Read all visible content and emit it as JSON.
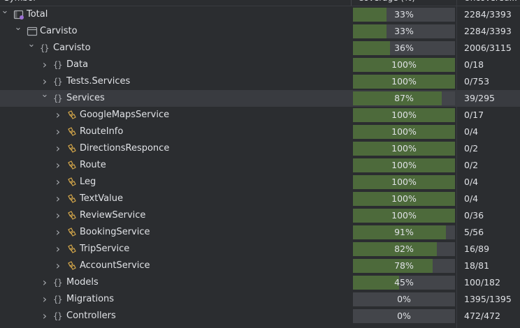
{
  "header": {
    "symbol": "Symbol",
    "coverage": "Coverage (%)",
    "lines": "Uncovered..."
  },
  "rows": [
    {
      "label": "Total",
      "pct": "33%",
      "frac": 0.33,
      "lines": "2284/3393",
      "depth": 0,
      "chev": "down",
      "icon": "total"
    },
    {
      "label": "Carvisto",
      "pct": "33%",
      "frac": 0.33,
      "lines": "2284/3393",
      "depth": 1,
      "chev": "down",
      "icon": "module"
    },
    {
      "label": "Carvisto",
      "pct": "36%",
      "frac": 0.36,
      "lines": "2006/3115",
      "depth": 2,
      "chev": "down",
      "icon": "ns"
    },
    {
      "label": "Data",
      "pct": "100%",
      "frac": 1.0,
      "lines": "0/18",
      "depth": 3,
      "chev": "right",
      "icon": "ns"
    },
    {
      "label": "Tests.Services",
      "pct": "100%",
      "frac": 1.0,
      "lines": "0/753",
      "depth": 3,
      "chev": "right",
      "icon": "ns"
    },
    {
      "label": "Services",
      "pct": "87%",
      "frac": 0.87,
      "lines": "39/295",
      "depth": 3,
      "chev": "down",
      "icon": "ns",
      "selected": true
    },
    {
      "label": "GoogleMapsService",
      "pct": "100%",
      "frac": 1.0,
      "lines": "0/17",
      "depth": 4,
      "chev": "right",
      "icon": "class"
    },
    {
      "label": "RouteInfo",
      "pct": "100%",
      "frac": 1.0,
      "lines": "0/4",
      "depth": 4,
      "chev": "right",
      "icon": "class"
    },
    {
      "label": "DirectionsResponce",
      "pct": "100%",
      "frac": 1.0,
      "lines": "0/2",
      "depth": 4,
      "chev": "right",
      "icon": "class"
    },
    {
      "label": "Route",
      "pct": "100%",
      "frac": 1.0,
      "lines": "0/2",
      "depth": 4,
      "chev": "right",
      "icon": "class"
    },
    {
      "label": "Leg",
      "pct": "100%",
      "frac": 1.0,
      "lines": "0/4",
      "depth": 4,
      "chev": "right",
      "icon": "class"
    },
    {
      "label": "TextValue",
      "pct": "100%",
      "frac": 1.0,
      "lines": "0/4",
      "depth": 4,
      "chev": "right",
      "icon": "class"
    },
    {
      "label": "ReviewService",
      "pct": "100%",
      "frac": 1.0,
      "lines": "0/36",
      "depth": 4,
      "chev": "right",
      "icon": "class"
    },
    {
      "label": "BookingService",
      "pct": "91%",
      "frac": 0.91,
      "lines": "5/56",
      "depth": 4,
      "chev": "right",
      "icon": "class"
    },
    {
      "label": "TripService",
      "pct": "82%",
      "frac": 0.82,
      "lines": "16/89",
      "depth": 4,
      "chev": "right",
      "icon": "class"
    },
    {
      "label": "AccountService",
      "pct": "78%",
      "frac": 0.78,
      "lines": "18/81",
      "depth": 4,
      "chev": "right",
      "icon": "class"
    },
    {
      "label": "Models",
      "pct": "45%",
      "frac": 0.45,
      "lines": "100/182",
      "depth": 3,
      "chev": "right",
      "icon": "ns"
    },
    {
      "label": "Migrations",
      "pct": "0%",
      "frac": 0.0,
      "lines": "1395/1395",
      "depth": 3,
      "chev": "right",
      "icon": "ns"
    },
    {
      "label": "Controllers",
      "pct": "0%",
      "frac": 0.0,
      "lines": "472/472",
      "depth": 3,
      "chev": "right",
      "icon": "ns"
    }
  ],
  "colors": {
    "fill": "#4d6a3b",
    "track": "#43454a",
    "selected": "#393b40",
    "class_icon": "#d6a84a"
  },
  "icons": {
    "total": "total-coverage-icon",
    "module": "module-icon",
    "ns": "namespace-icon",
    "class": "class-icon"
  }
}
